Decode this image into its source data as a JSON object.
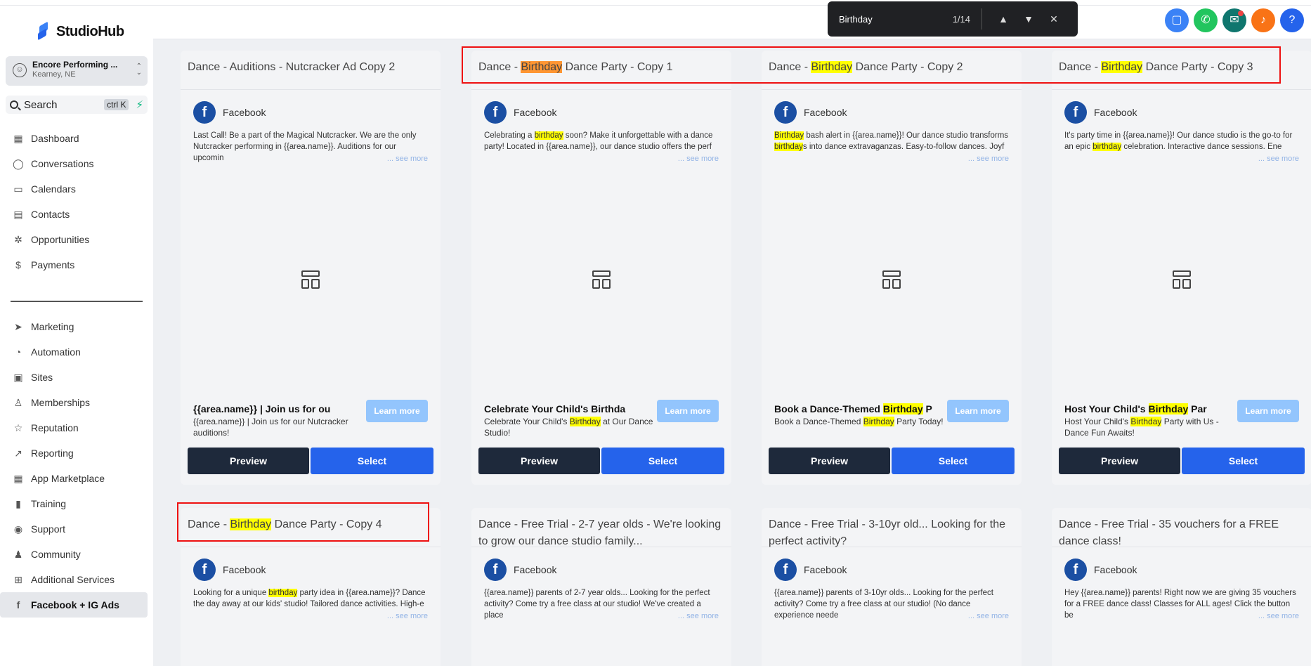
{
  "find_bar": {
    "query": "Birthday",
    "count": "1/14",
    "prev_icon": "▲",
    "next_icon": "▼",
    "close_icon": "✕"
  },
  "brand": {
    "name": "StudioHub"
  },
  "account": {
    "name": "Encore Performing ...",
    "location": "Kearney, NE"
  },
  "search": {
    "label": "Search",
    "shortcut": "ctrl K"
  },
  "nav": {
    "main": [
      {
        "label": "Dashboard",
        "icon": "▦"
      },
      {
        "label": "Conversations",
        "icon": "◯"
      },
      {
        "label": "Calendars",
        "icon": "▭"
      },
      {
        "label": "Contacts",
        "icon": "▤"
      },
      {
        "label": "Opportunities",
        "icon": "✲"
      },
      {
        "label": "Payments",
        "icon": "$"
      }
    ],
    "secondary": [
      {
        "label": "Marketing",
        "icon": "➤"
      },
      {
        "label": "Automation",
        "icon": "◔"
      },
      {
        "label": "Sites",
        "icon": "▣"
      },
      {
        "label": "Memberships",
        "icon": "♙"
      },
      {
        "label": "Reputation",
        "icon": "☆"
      },
      {
        "label": "Reporting",
        "icon": "↗"
      },
      {
        "label": "App Marketplace",
        "icon": "▦"
      },
      {
        "label": "Training",
        "icon": "▮"
      },
      {
        "label": "Support",
        "icon": "◉"
      },
      {
        "label": "Community",
        "icon": "♟"
      },
      {
        "label": "Additional Services",
        "icon": "⊞"
      },
      {
        "label": "Facebook + IG Ads",
        "icon": "f"
      }
    ]
  },
  "topbar_icons": [
    {
      "name": "chat-icon",
      "glyph": "▢",
      "color": "#3b82f6"
    },
    {
      "name": "phone-icon",
      "glyph": "✆",
      "color": "#22c55e"
    },
    {
      "name": "megaphone-icon",
      "glyph": "✉",
      "color": "#0f766e"
    },
    {
      "name": "bell-icon",
      "glyph": "♪",
      "color": "#f97316"
    },
    {
      "name": "help-icon",
      "glyph": "?",
      "color": "#2563eb"
    }
  ],
  "platform": "Facebook",
  "see_more": "... see more",
  "learn_more": "Learn more",
  "preview_label": "Preview",
  "select_label": "Select",
  "cards": [
    {
      "title": [
        "Dance - Auditions - Nutcracker Ad Copy 2"
      ],
      "text": [
        "Last Call! Be a part of the Magical Nutcracker. We are the only Nutcracker performing in {{area.name}}. Auditions for our upcomin"
      ],
      "headline": [
        "{{area.name}} | Join us for ou"
      ],
      "description": [
        "{{area.name}} | Join us for our Nutcracker auditions!"
      ]
    },
    {
      "title": [
        "Dance - ",
        "Birthday",
        " Dance Party - Copy 1"
      ],
      "title_current": true,
      "text": [
        "Celebrating a ",
        "birthday",
        " soon? Make it unforgettable with a dance party! Located in {{area.name}}, our dance studio offers the perf"
      ],
      "headline": [
        "Celebrate Your Child's Birthda"
      ],
      "description": [
        "Celebrate Your Child's ",
        "Birthday",
        " at Our Dance Studio!"
      ]
    },
    {
      "title": [
        "Dance - ",
        "Birthday",
        " Dance Party - Copy 2"
      ],
      "text": [
        "",
        "Birthday",
        " bash alert in {{area.name}}! Our dance studio transforms ",
        "birthday",
        "s into dance extravaganzas. Easy-to-follow dances. Joyf"
      ],
      "headline": [
        "Book a Dance-Themed ",
        "Birthday",
        " P"
      ],
      "description": [
        "Book a Dance-Themed ",
        "Birthday",
        " Party Today!"
      ]
    },
    {
      "title": [
        "Dance - ",
        "Birthday",
        " Dance Party - Copy 3"
      ],
      "text": [
        "It's party time in {{area.name}}! Our dance studio is the go-to for an epic ",
        "birthday",
        " celebration. Interactive dance sessions. Ene"
      ],
      "headline": [
        "Host Your Child's ",
        "Birthday",
        " Par"
      ],
      "description": [
        "Host Your Child's ",
        "Birthday",
        " Party with Us - Dance Fun Awaits!"
      ]
    },
    {
      "title": [
        "Dance - ",
        "Birthday",
        " Dance Party - Copy 4"
      ],
      "text": [
        "Looking for a unique ",
        "birthday",
        " party idea in {{area.name}}? Dance the day away at our kids' studio! Tailored dance activities. High-e"
      ]
    },
    {
      "title": [
        "Dance - Free Trial - 2-7 year olds - We're looking to grow our dance studio family..."
      ],
      "text": [
        "{{area.name}} parents of 2-7 year olds... Looking for the perfect activity? Come try a free class at our studio! We've created a place"
      ]
    },
    {
      "title": [
        "Dance - Free Trial - 3-10yr old... Looking for the perfect activity?"
      ],
      "text": [
        "{{area.name}} parents of 3-10yr olds... Looking for the perfect activity? Come try a free class at our studio! (No dance experience neede"
      ]
    },
    {
      "title": [
        "Dance - Free Trial - 35 vouchers for a FREE dance class!"
      ],
      "text": [
        "Hey {{area.name}} parents! Right now we are giving 35 vouchers for a FREE dance class! Classes for ALL ages! Click the button be"
      ]
    }
  ]
}
